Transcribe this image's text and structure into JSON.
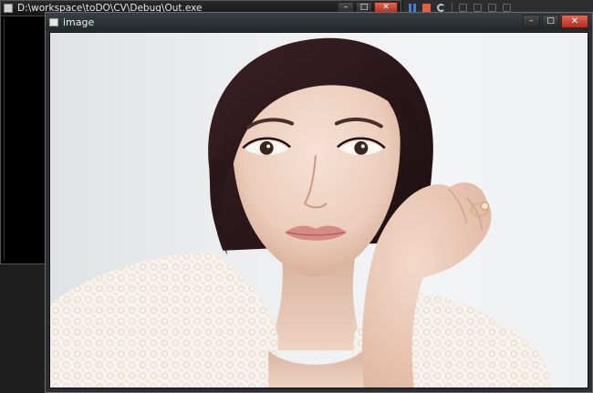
{
  "console_window": {
    "title": "D:\\workspace\\toDO\\CV\\Debug\\Out.exe",
    "buttons": {
      "minimize": "–",
      "maximize": "□",
      "close": "✕"
    }
  },
  "image_window": {
    "title": "image",
    "buttons": {
      "minimize": "–",
      "maximize": "□",
      "close": "✕"
    }
  },
  "icons": {
    "toolbar": [
      "pause-icon",
      "stop-icon",
      "restart-icon",
      "step-icon",
      "step-into-icon",
      "step-out-icon",
      "hex-icon"
    ]
  },
  "colors": {
    "console_bg": "#000000",
    "close_button": "#c94534",
    "photo_background": "#eceef0",
    "hair": "#2a1719",
    "skin": "#f1d6c6",
    "blouse": "#f6f1ea"
  }
}
